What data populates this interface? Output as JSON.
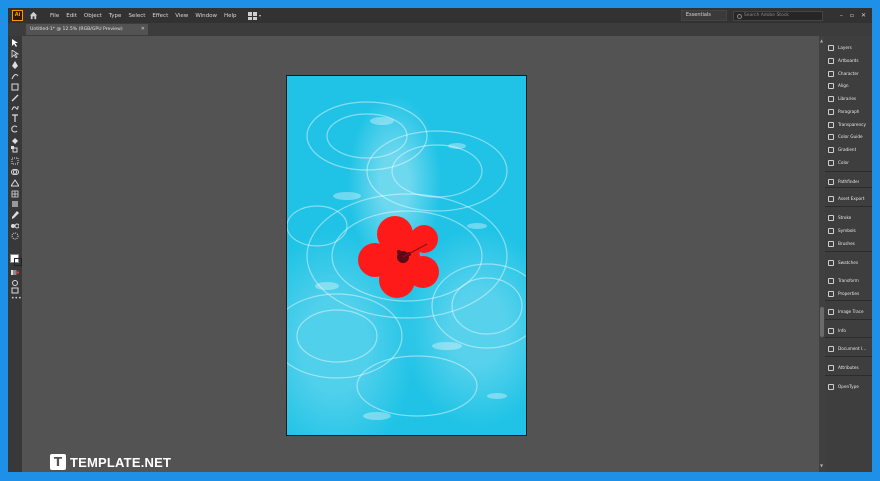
{
  "app_icon": "Ai",
  "menu": [
    "File",
    "Edit",
    "Object",
    "Type",
    "Select",
    "Effect",
    "View",
    "Window",
    "Help"
  ],
  "workspace": "Essentials",
  "search_placeholder": "Search Adobe Stock",
  "window_controls": [
    "–",
    "▫",
    "✕"
  ],
  "document_tab": {
    "title": "Untitled-1* @ 12.5% (RGB/GPU Preview)",
    "close": "✕"
  },
  "panels": [
    {
      "label": "Layers",
      "icon": "layers-icon"
    },
    {
      "label": "Artboards",
      "icon": "artboards-icon"
    },
    {
      "label": "Character",
      "icon": "character-icon"
    },
    {
      "label": "Align",
      "icon": "align-icon"
    },
    {
      "label": "Libraries",
      "icon": "libraries-icon"
    },
    {
      "label": "Paragraph",
      "icon": "paragraph-icon"
    },
    {
      "label": "Transparency",
      "icon": "transparency-icon"
    },
    {
      "label": "Color Guide",
      "icon": "color-guide-icon"
    },
    {
      "label": "Gradient",
      "icon": "gradient-icon"
    },
    {
      "label": "Color",
      "icon": "color-icon"
    },
    {
      "label": "Pathfinder",
      "icon": "pathfinder-icon"
    },
    {
      "label": "Asset Export",
      "icon": "asset-export-icon"
    },
    {
      "label": "Stroke",
      "icon": "stroke-icon"
    },
    {
      "label": "Symbols",
      "icon": "symbols-icon"
    },
    {
      "label": "Brushes",
      "icon": "brushes-icon"
    },
    {
      "label": "Swatches",
      "icon": "swatches-icon"
    },
    {
      "label": "Transform",
      "icon": "transform-icon"
    },
    {
      "label": "Properties",
      "icon": "properties-icon"
    },
    {
      "label": "Image Trace",
      "icon": "image-trace-icon"
    },
    {
      "label": "Info",
      "icon": "info-icon"
    },
    {
      "label": "Document I...",
      "icon": "document-info-icon"
    },
    {
      "label": "Attributes",
      "icon": "attributes-icon"
    },
    {
      "label": "OpenType",
      "icon": "opentype-icon"
    }
  ],
  "tools": [
    "selection-tool",
    "direct-selection-tool",
    "pen-tool",
    "curvature-tool",
    "rectangle-tool",
    "paintbrush-tool",
    "shaper-tool",
    "type-tool",
    "rotate-tool",
    "eraser-tool",
    "scale-tool",
    "free-transform-tool",
    "shape-builder-tool",
    "perspective-grid-tool",
    "mesh-tool",
    "gradient-tool",
    "eyedropper-tool",
    "blend-tool",
    "symbol-sprayer-tool",
    "column-graph-tool",
    "artboard-tool",
    "slice-tool",
    "hand-tool",
    "zoom-tool"
  ],
  "watermark": {
    "logo": "T",
    "text": "TEMPLATE.NET"
  },
  "colors": {
    "ui_bg": "#535353",
    "menubar": "#323232",
    "frame": "#1e90e8",
    "water": "#20c3e6",
    "flower": "#ff1a1a"
  }
}
